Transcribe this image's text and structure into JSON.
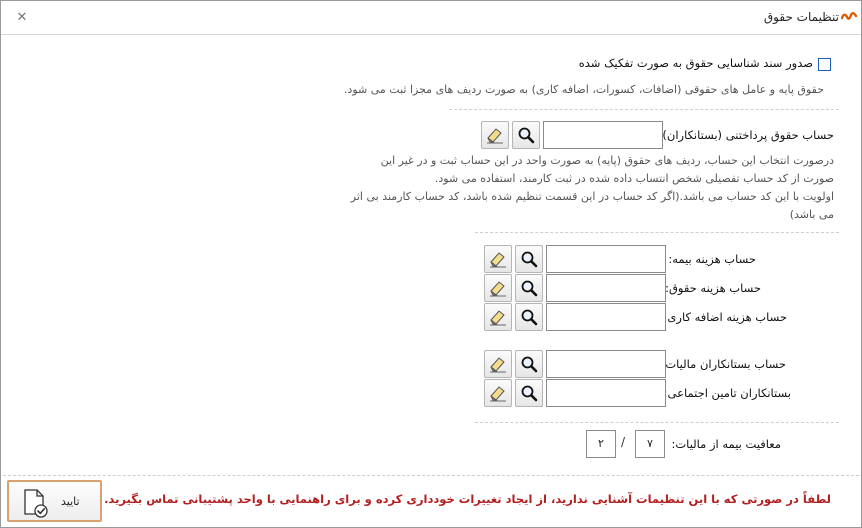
{
  "window": {
    "title": "تنظیمات حقوق",
    "close_icon": "close-icon",
    "logo_icon": "app-logo-icon",
    "logo_color": "#e05a00"
  },
  "split_section": {
    "checkbox_checked": false,
    "checkbox_label": "صدور سند شناسایی حقوق به صورت تفکیک شده",
    "description": "حقوق پایه و عامل های حقوقی (اضافات، کسورات، اضافه کاری) به صورت ردیف های مجزا ثبت می شود."
  },
  "payable_account": {
    "label": "حساب حقوق پرداختنی (بستانکاران):",
    "value": "",
    "desc_line1": "درصورت انتخاب این حساب،  ردیف های حقوق (پایه) به صورت واحد در این حساب ثبت و در غیر این",
    "desc_line2": "صورت از کد حساب تفصیلی شخص انتساب داده شده در ثبت کارمند، استفاده می شود.",
    "desc_line3": "اولویت با این کد حساب می باشد.(اگر کد حساب در این قسمت تنظیم شده باشد، کد حساب کارمند بی اثر",
    "desc_line4": "می باشد)"
  },
  "expense_accounts": [
    {
      "label": "حساب هزینه بیمه:",
      "value": ""
    },
    {
      "label": "حساب هزینه حقوق:",
      "value": ""
    },
    {
      "label": "حساب هزینه اضافه کاری:",
      "value": ""
    }
  ],
  "creditor_accounts": [
    {
      "label": "حساب بستانکاران مالیات:",
      "value": ""
    },
    {
      "label": "بستانکاران تامین اجتماعی:",
      "value": ""
    }
  ],
  "insurance_exemption": {
    "label": "معافیت بیمه از مالیات:",
    "numerator": "۲",
    "separator": "/",
    "denominator": "۷"
  },
  "footer": {
    "warning": "لطفاً در صورتی که با این تنظیمات آشنایی ندارید، از ایجاد تغییرات خودداری کرده و برای راهنمایی با واحد پشتیبانی تماس بگیرید.",
    "warning_color": "#b32020",
    "confirm_label": "تایید",
    "confirm_icon": "document-check-icon"
  },
  "icons": {
    "search": "search-icon",
    "edit": "edit-eraser-icon"
  }
}
